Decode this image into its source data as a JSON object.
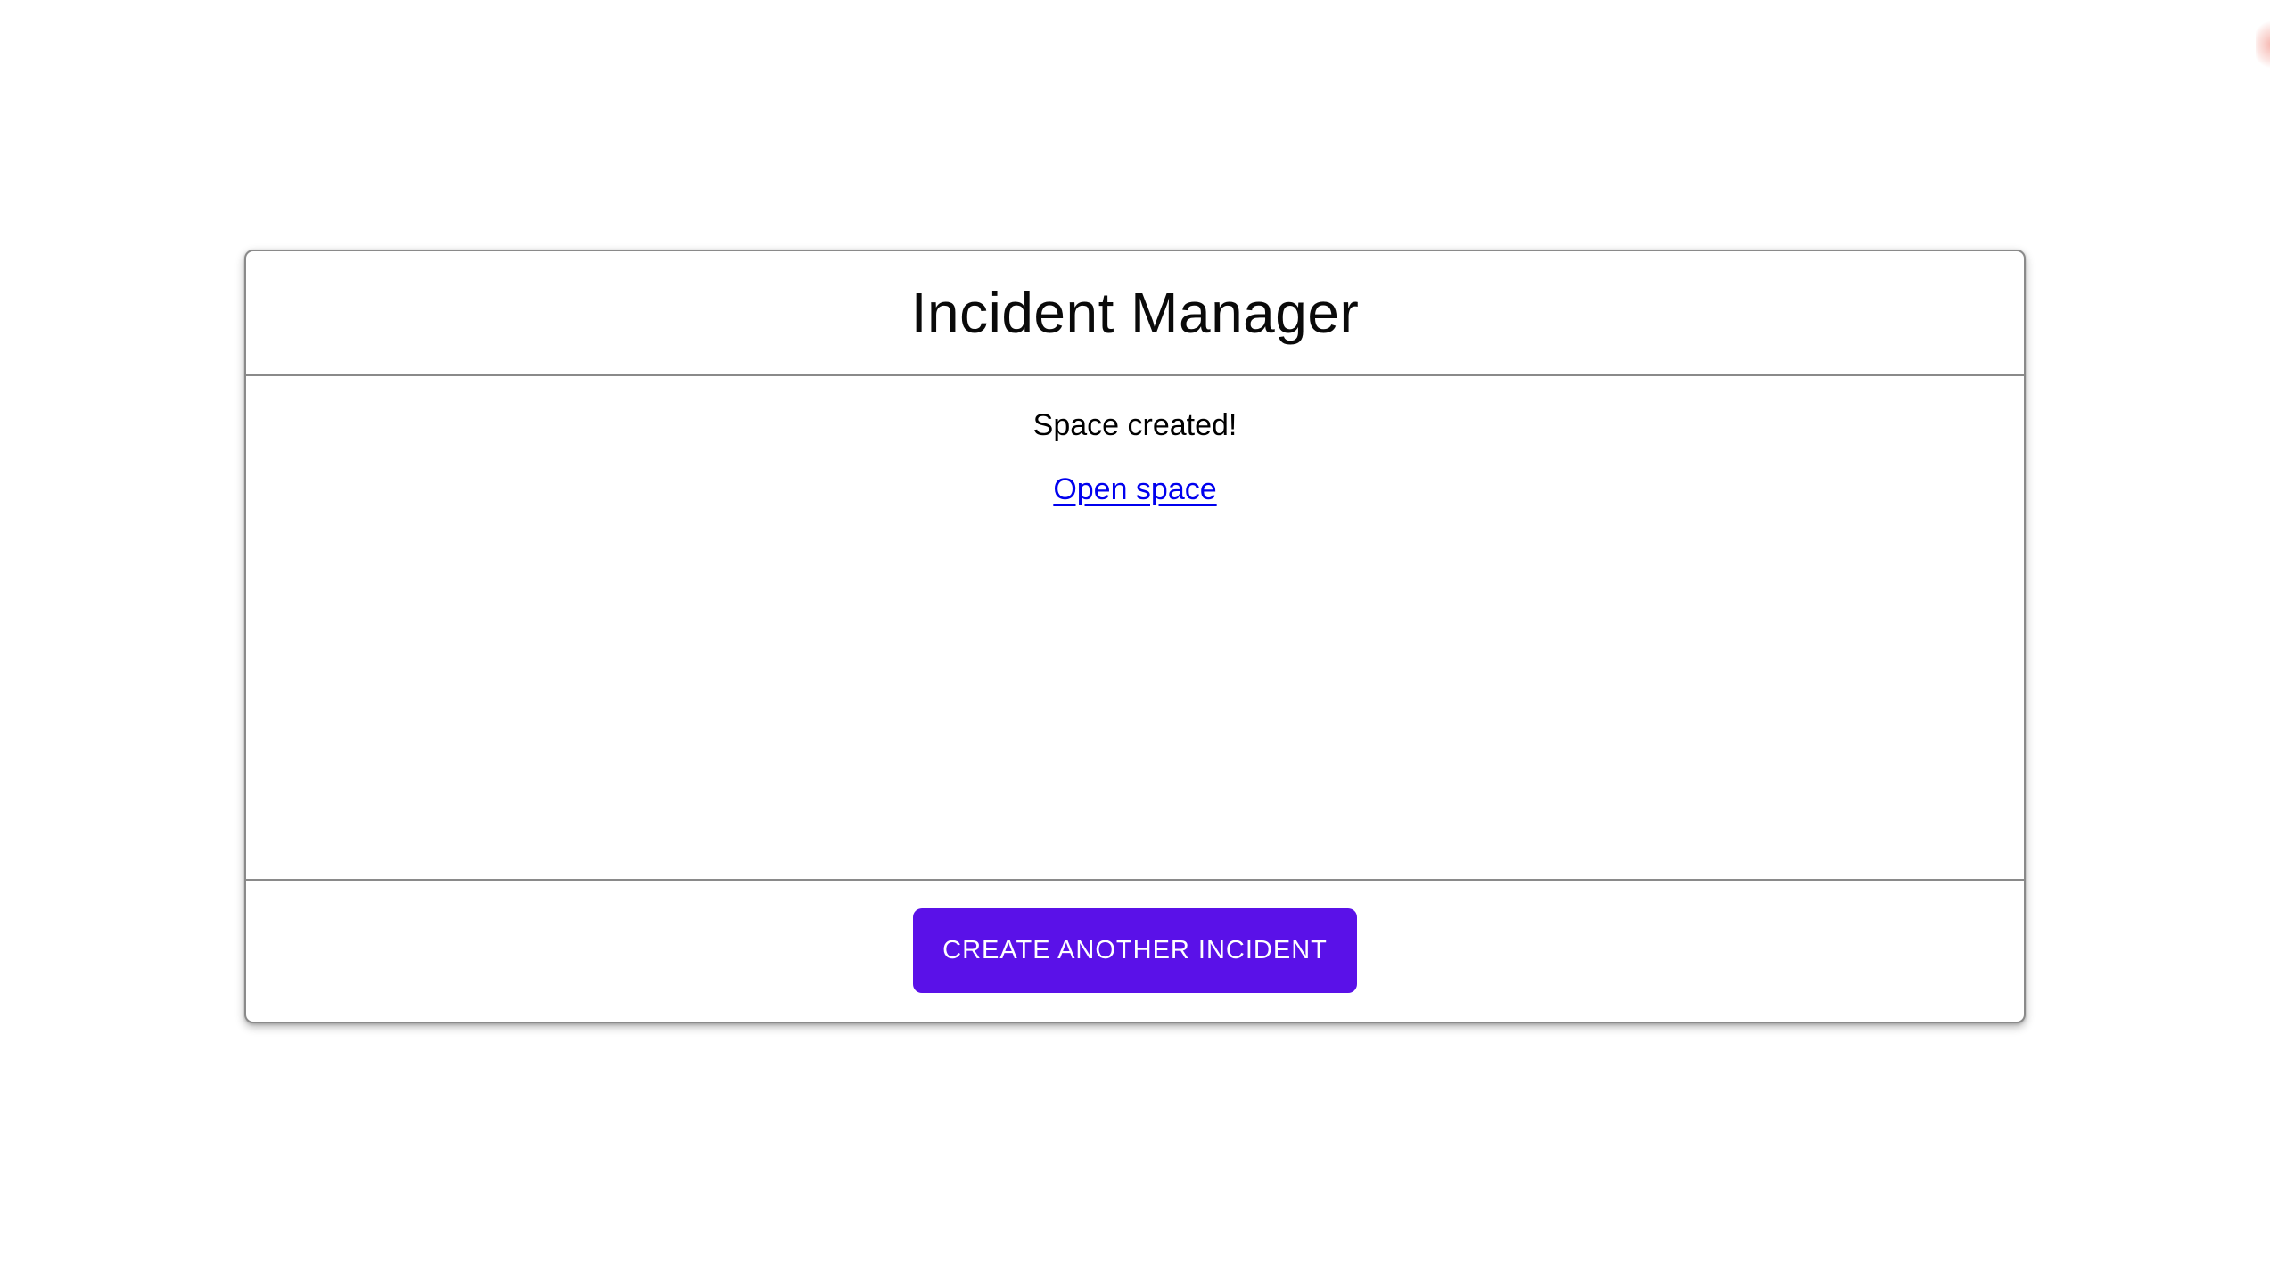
{
  "header": {
    "title": "Incident Manager"
  },
  "content": {
    "status_message": "Space created!",
    "open_space_link": "Open space"
  },
  "footer": {
    "create_button_label": "CREATE ANOTHER INCIDENT"
  },
  "colors": {
    "button_background": "#5a11e8",
    "button_text": "#ffffff",
    "link": "#0000ee",
    "card_border": "#8a8a8a",
    "title_text": "#0a0a0a",
    "page_background": "#ffffff"
  }
}
